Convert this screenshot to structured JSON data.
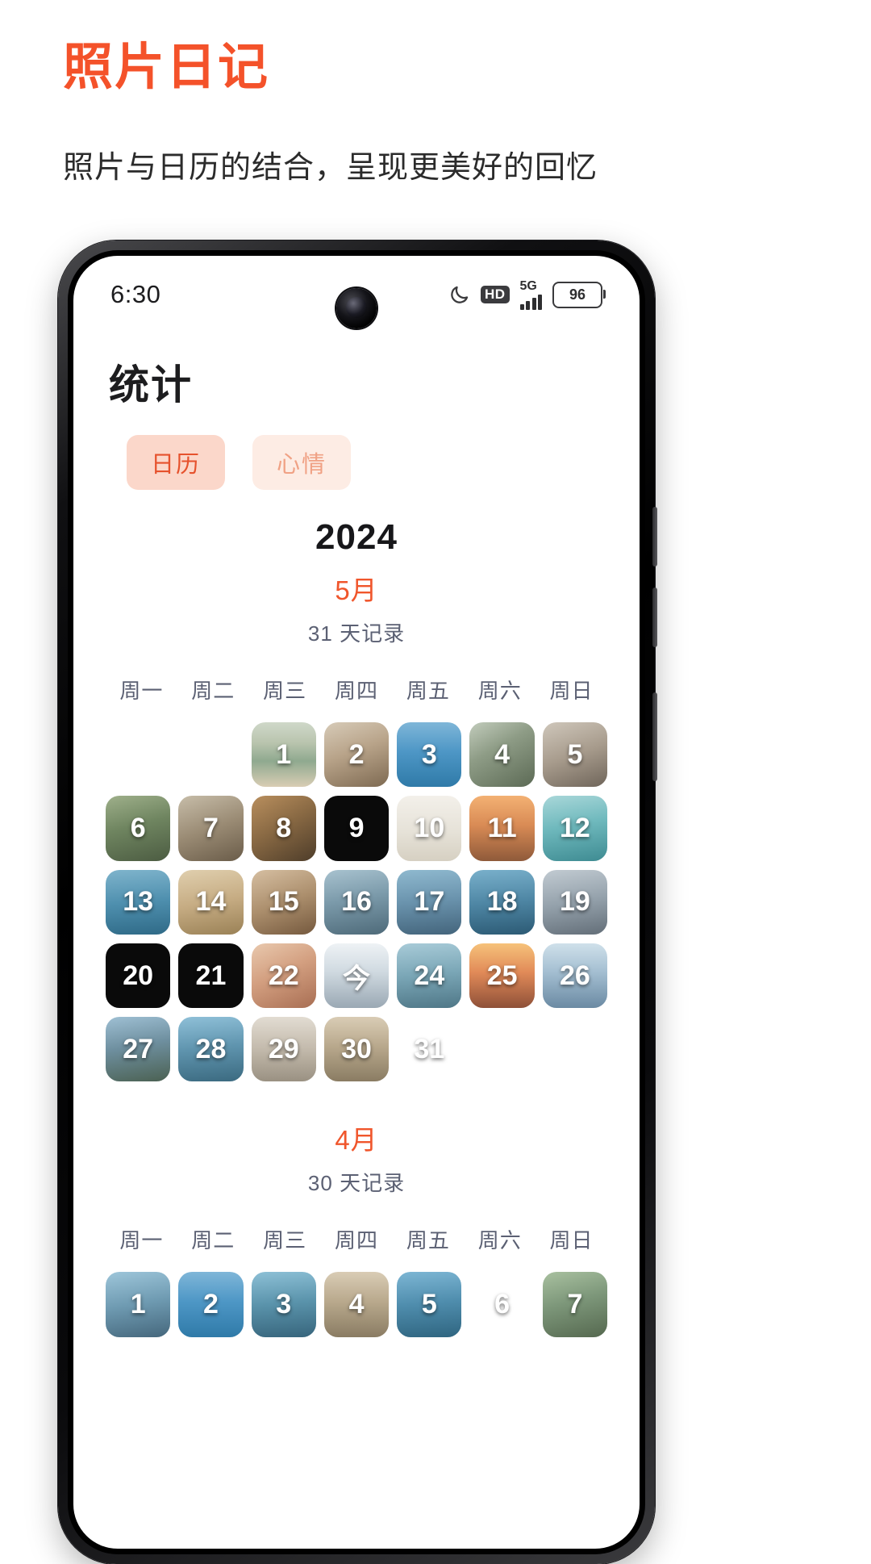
{
  "promo": {
    "title": "照片日记",
    "subtitle": "照片与日历的结合，呈现更美好的回忆",
    "title_color": "#f4522a"
  },
  "statusbar": {
    "time": "6:30",
    "moon_icon": "moon-icon",
    "hd_label": "HD",
    "network_label": "5G",
    "signal_bars": 4,
    "battery_level": "96"
  },
  "app": {
    "page_title": "统计",
    "tabs": [
      {
        "label": "日历",
        "active": true
      },
      {
        "label": "心情",
        "active": false
      }
    ],
    "weekdays": [
      "周一",
      "周二",
      "周三",
      "周四",
      "周五",
      "周六",
      "周日"
    ],
    "months": [
      {
        "year": "2024",
        "month_label": "5月",
        "record_label": "31 天记录",
        "lead_blanks": 2,
        "days": [
          {
            "label": "1",
            "has_photo": true,
            "style": "beach"
          },
          {
            "label": "2",
            "has_photo": true,
            "style": "interior"
          },
          {
            "label": "3",
            "has_photo": true,
            "style": "sea"
          },
          {
            "label": "4",
            "has_photo": true,
            "style": "street"
          },
          {
            "label": "5",
            "has_photo": true,
            "style": "stairs"
          },
          {
            "label": "6",
            "has_photo": true,
            "style": "hill"
          },
          {
            "label": "7",
            "has_photo": true,
            "style": "village"
          },
          {
            "label": "8",
            "has_photo": true,
            "style": "temple"
          },
          {
            "label": "9",
            "has_photo": false,
            "style": "dark"
          },
          {
            "label": "10",
            "has_photo": true,
            "style": "poster"
          },
          {
            "label": "11",
            "has_photo": true,
            "style": "dusk"
          },
          {
            "label": "12",
            "has_photo": true,
            "style": "pool"
          },
          {
            "label": "13",
            "has_photo": true,
            "style": "harbor"
          },
          {
            "label": "14",
            "has_photo": true,
            "style": "sand"
          },
          {
            "label": "15",
            "has_photo": true,
            "style": "room"
          },
          {
            "label": "16",
            "has_photo": true,
            "style": "town"
          },
          {
            "label": "17",
            "has_photo": true,
            "style": "road"
          },
          {
            "label": "18",
            "has_photo": true,
            "style": "surf"
          },
          {
            "label": "19",
            "has_photo": true,
            "style": "tower"
          },
          {
            "label": "20",
            "has_photo": false,
            "style": "dark"
          },
          {
            "label": "21",
            "has_photo": false,
            "style": "dark"
          },
          {
            "label": "22",
            "has_photo": true,
            "style": "food"
          },
          {
            "label": "今",
            "has_photo": true,
            "style": "snow",
            "is_today": true
          },
          {
            "label": "24",
            "has_photo": true,
            "style": "park"
          },
          {
            "label": "25",
            "has_photo": true,
            "style": "sunset"
          },
          {
            "label": "26",
            "has_photo": true,
            "style": "cloud"
          },
          {
            "label": "27",
            "has_photo": true,
            "style": "mountain"
          },
          {
            "label": "28",
            "has_photo": true,
            "style": "lake"
          },
          {
            "label": "29",
            "has_photo": true,
            "style": "shore"
          },
          {
            "label": "30",
            "has_photo": true,
            "style": "coast"
          },
          {
            "label": "31",
            "has_photo": true,
            "style": "ocean"
          }
        ]
      },
      {
        "year": "",
        "month_label": "4月",
        "record_label": "30 天记录",
        "lead_blanks": 0,
        "days": [
          {
            "label": "1",
            "has_photo": true,
            "style": "lighthouse"
          },
          {
            "label": "2",
            "has_photo": true,
            "style": "sea"
          },
          {
            "label": "3",
            "has_photo": true,
            "style": "boat"
          },
          {
            "label": "4",
            "has_photo": true,
            "style": "coast"
          },
          {
            "label": "5",
            "has_photo": true,
            "style": "bay"
          },
          {
            "label": "6",
            "has_photo": true,
            "style": "ocean"
          },
          {
            "label": "7",
            "has_photo": true,
            "style": "villa"
          }
        ]
      }
    ]
  }
}
